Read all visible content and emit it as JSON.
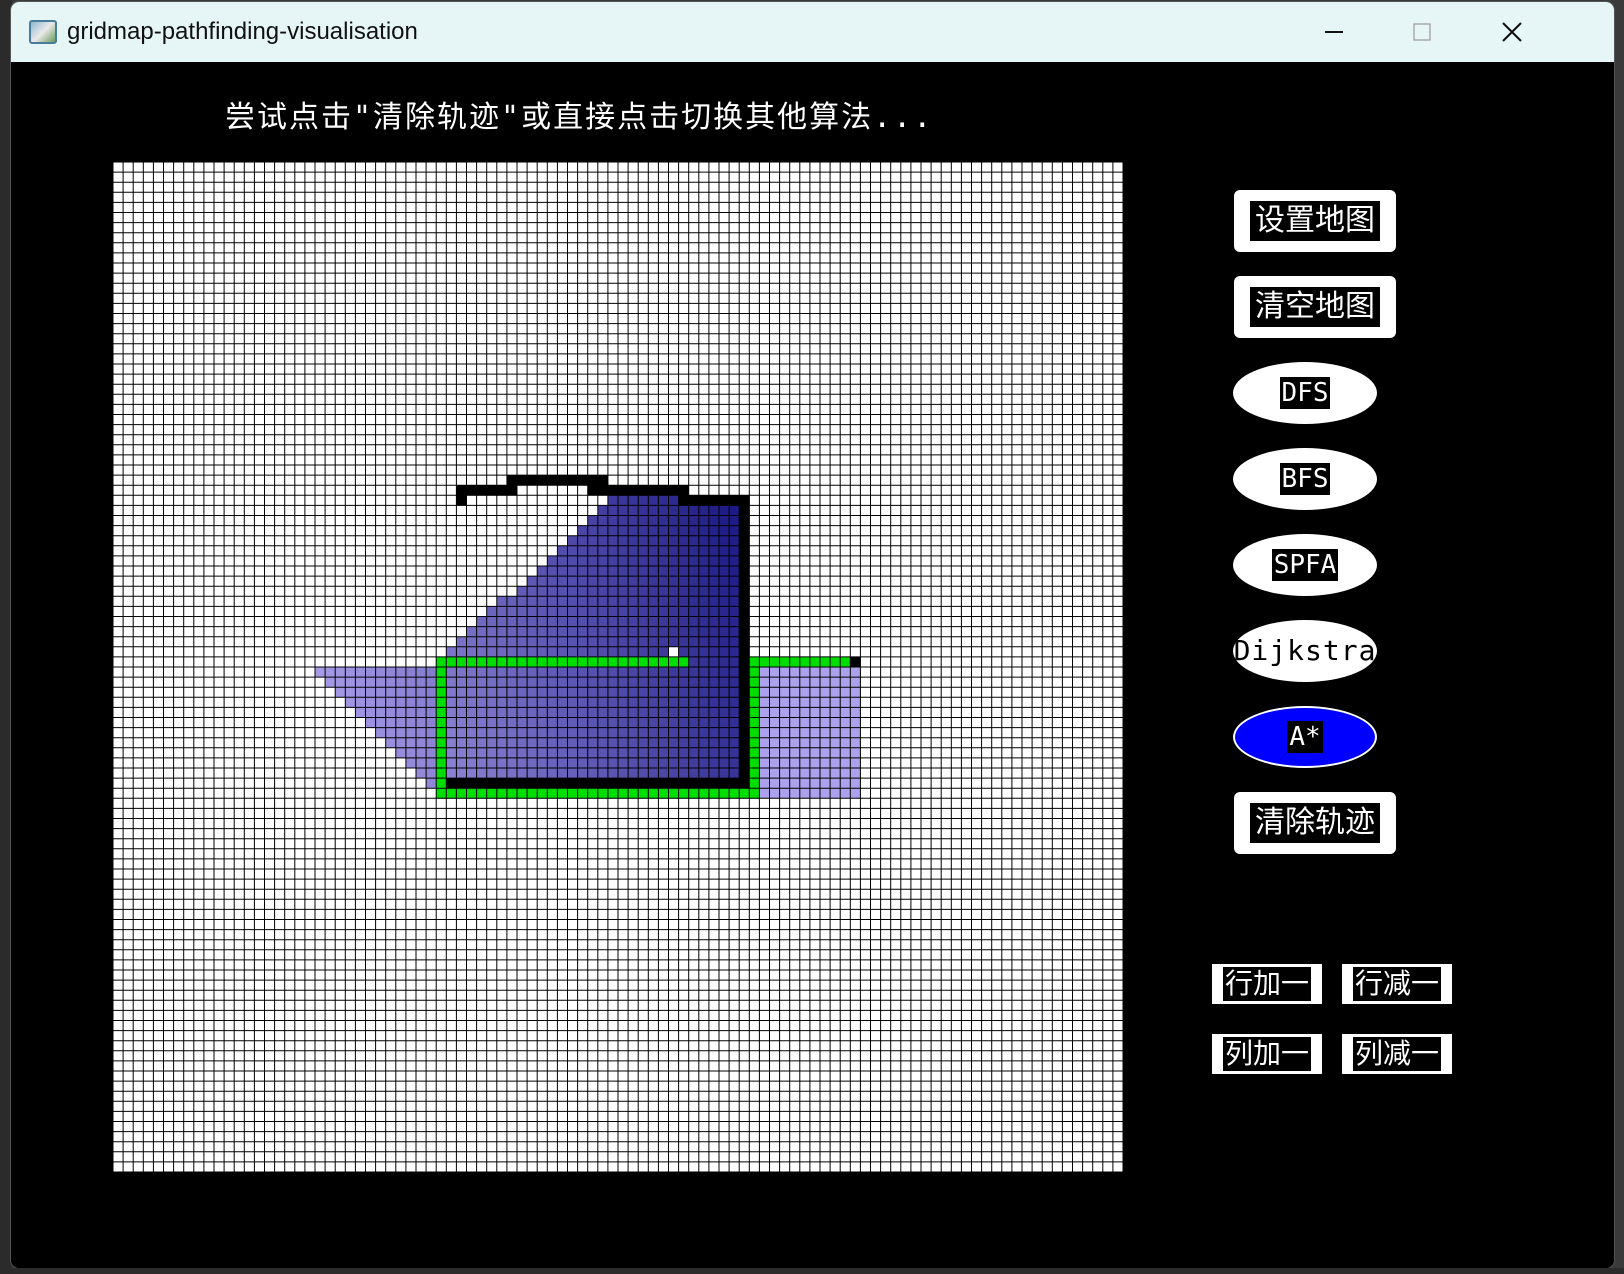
{
  "window": {
    "title": "gridmap-pathfinding-visualisation",
    "minimize_icon": "minimize-icon",
    "maximize_icon": "maximize-icon",
    "close_icon": "close-icon"
  },
  "hint": "尝试点击\"清除轨迹\"或直接点击切换其他算法...",
  "buttons": {
    "set_map": "设置地图",
    "clear_map": "清空地图",
    "dfs": "DFS",
    "bfs": "BFS",
    "spfa": "SPFA",
    "dijkstra": "Dijkstra",
    "astar": "A*",
    "clear_trace": "清除轨迹",
    "row_add": "行加一",
    "row_sub": "行减一",
    "col_add": "列加一",
    "col_sub": "列减一"
  },
  "active_algorithm": "A*",
  "grid": {
    "rows": 100,
    "cols": 100,
    "colors": {
      "empty": "#ffffff",
      "grid_line": "#000000",
      "wall": "#000000",
      "path": "#00dd00",
      "visited_light": "#b4a9f2",
      "visited_dark": "#14127e"
    }
  }
}
